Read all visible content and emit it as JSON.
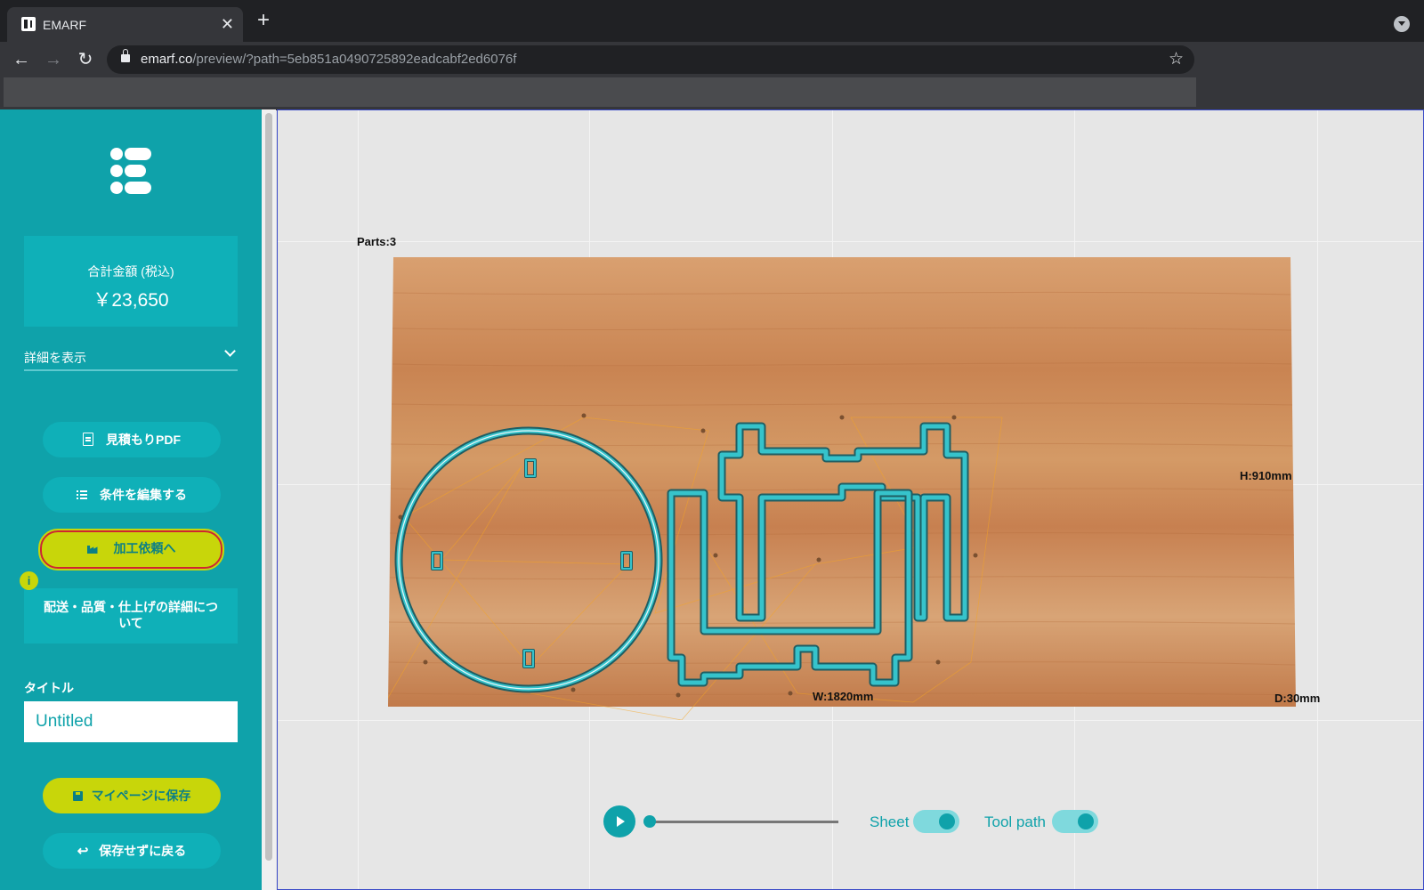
{
  "browser": {
    "tab_title": "EMARF",
    "tab_close": "✕",
    "new_tab": "+",
    "url_host": "emarf.co",
    "url_path": "/preview/?path=5eb851a0490725892eadcabf2ed6076f"
  },
  "sidebar": {
    "price_label": "合計金額 (税込)",
    "price_value": "￥23,650",
    "details_toggle": "詳細を表示",
    "buttons": {
      "estimate_pdf": "見積もりPDF",
      "edit_conditions": "条件を編集する",
      "order": "加工依頼へ",
      "save_mypage": "マイページに保存",
      "back_without_save": "保存せずに戻る"
    },
    "info_badge": "i",
    "info_card": "配送・品質・仕上げの詳細について",
    "title_label": "タイトル",
    "title_placeholder": "Untitled"
  },
  "viewer": {
    "parts_label": "Parts:3",
    "height_label": "H:910mm",
    "width_label": "W:1820mm",
    "depth_label": "D:30mm",
    "controls": {
      "sheet_label": "Sheet",
      "sheet_on": true,
      "toolpath_label": "Tool path",
      "toolpath_on": true,
      "playback_progress": 0
    }
  },
  "colors": {
    "sidebar": "#0fa2aa",
    "accent_yellow": "#c8d60a",
    "toolpath": "#1fb8c0",
    "wood": "#c98452"
  }
}
